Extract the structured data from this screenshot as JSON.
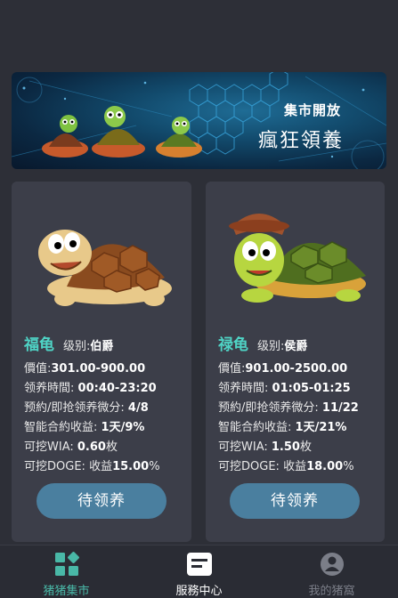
{
  "banner": {
    "title_small": "集市開放",
    "title_large": "瘋狂領養"
  },
  "cards": [
    {
      "name": "福龟",
      "level_label": "级别:",
      "level": "伯爵",
      "price_label": "價值:",
      "price": "301.00-900.00",
      "time_label": "领养時間:",
      "time": "00:40-23:20",
      "reserve_label": "预約/即抢领养微分:",
      "reserve": "4/8",
      "income_label": "智能合約收益:",
      "income": "1天/9%",
      "wia_label": "可挖WIA:",
      "wia_value": "0.60",
      "wia_unit": "枚",
      "doge_label": "可挖DOGE:",
      "doge_prefix": "收益",
      "doge_value": "15.00",
      "doge_unit": "%",
      "button": "待领养"
    },
    {
      "name": "禄龟",
      "level_label": "级别:",
      "level": "侯爵",
      "price_label": "價值:",
      "price": "901.00-2500.00",
      "time_label": "领养時間:",
      "time": "01:05-01:25",
      "reserve_label": "预約/即抢领养微分:",
      "reserve": "11/22",
      "income_label": "智能合約收益:",
      "income": "1天/21%",
      "wia_label": "可挖WIA:",
      "wia_value": "1.50",
      "wia_unit": "枚",
      "doge_label": "可挖DOGE:",
      "doge_prefix": "收益",
      "doge_value": "18.00",
      "doge_unit": "%",
      "button": "待领养"
    }
  ],
  "tabbar": {
    "tabs": [
      {
        "label": "猪猪集市",
        "icon": "grid-icon"
      },
      {
        "label": "服務中心",
        "icon": "service-icon"
      },
      {
        "label": "我的猪窩",
        "icon": "user-icon"
      }
    ]
  },
  "colors": {
    "accent": "#49b8a7",
    "turtle_name": "#4fd3c5",
    "button": "#4a7f9f",
    "card_bg": "#3c3e49",
    "page_bg": "#2d2f37"
  }
}
